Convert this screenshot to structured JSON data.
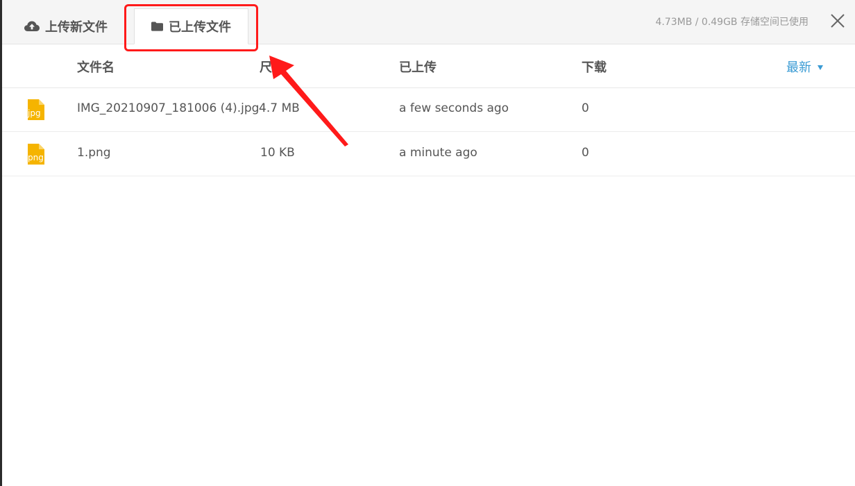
{
  "tabs": {
    "upload_new": "上传新文件",
    "uploaded": "已上传文件"
  },
  "usage_text": "4.73MB / 0.49GB 存储空间已使用",
  "columns": {
    "name": "文件名",
    "size": "尺寸",
    "uploaded": "已上传",
    "downloads": "下载"
  },
  "sort_label": "最新",
  "files": [
    {
      "ext": "jpg",
      "name": "IMG_20210907_181006 (4).jpg",
      "size": "4.7 MB",
      "uploaded": "a few seconds ago",
      "downloads": "0"
    },
    {
      "ext": "png",
      "name": "1.png",
      "size": "10 KB",
      "uploaded": "a minute ago",
      "downloads": "0"
    }
  ],
  "colors": {
    "accent": "#3a9bd4",
    "highlight": "#ff1a1a",
    "file_icon": "#f5b400"
  }
}
